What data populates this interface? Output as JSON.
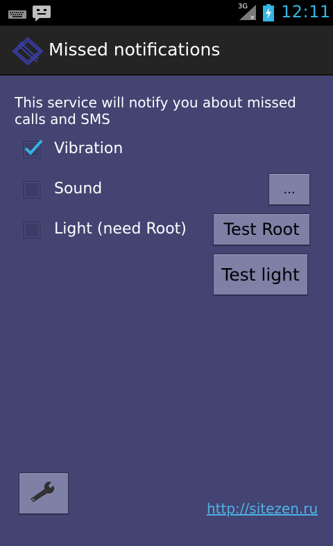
{
  "status_bar": {
    "network": "3G",
    "time": "12:11"
  },
  "action_bar": {
    "title": "Missed notifications"
  },
  "content": {
    "description": "This service will notify you about missed calls and SMS",
    "options": [
      {
        "label": "Vibration",
        "checked": true
      },
      {
        "label": "Sound",
        "checked": false
      },
      {
        "label": "Light (need Root)",
        "checked": false
      }
    ],
    "sound_picker_label": "...",
    "test_root_label": "Test Root",
    "test_light_label": "Test light",
    "link_text": "http://sitezen.ru"
  },
  "colors": {
    "accent": "#33b5e5",
    "background": "#434472",
    "button": "#7e80a6"
  },
  "icons": {
    "settings": "wrench-icon"
  }
}
